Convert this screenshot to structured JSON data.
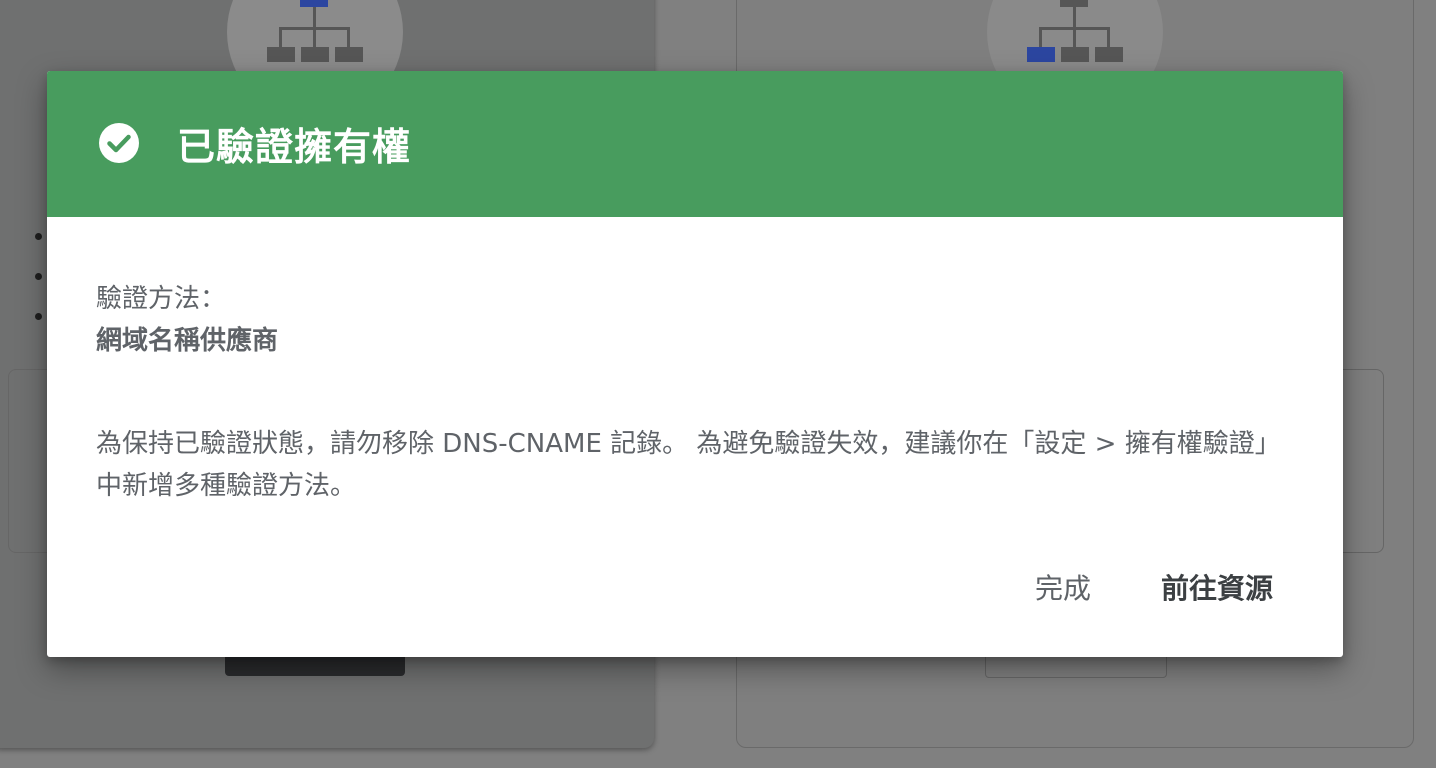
{
  "dialog": {
    "title": "已驗證擁有權",
    "header_color": "#489c5e",
    "header_icon": "check-circle-icon",
    "method_label": "驗證方法：",
    "method_value": "網域名稱供應商",
    "message": "為保持已驗證狀態，請勿移除 DNS-CNAME 記錄。 為避免驗證失效，建議你在「設定 > 擁有權驗證」中新增多種驗證方法。",
    "done_label": "完成",
    "go_to_property_label": "前往資源"
  }
}
